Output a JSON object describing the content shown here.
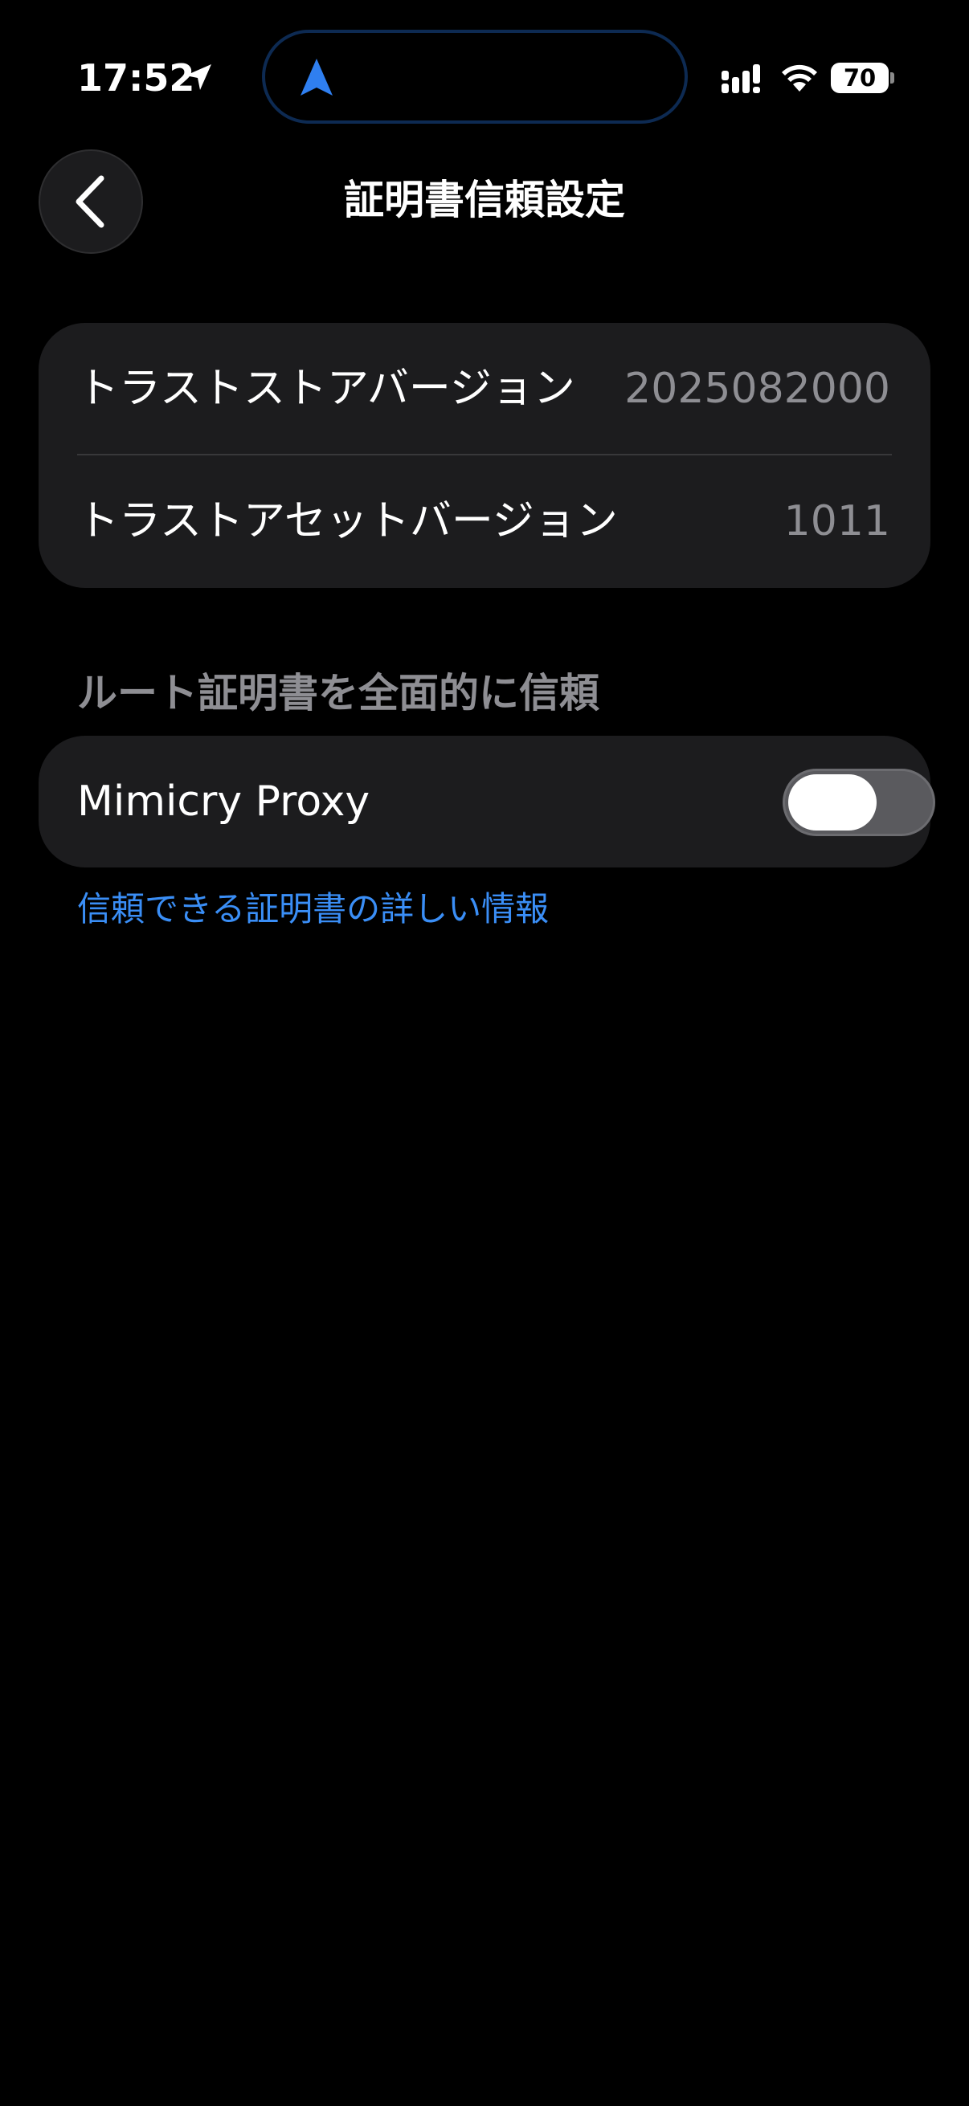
{
  "status_bar": {
    "time": "17:52",
    "battery_level": "70",
    "location_icon": "location-arrow-icon",
    "signal_icon": "cellular-signal-icon",
    "wifi_icon": "wifi-icon",
    "island_icon": "navigation-arrow-icon",
    "island_color": "#2f7ff0"
  },
  "header": {
    "back_icon": "chevron-left-icon",
    "title": "証明書信頼設定"
  },
  "versions": {
    "rows": [
      {
        "label": "トラストストアバージョン",
        "value": "2025082000"
      },
      {
        "label": "トラストアセットバージョン",
        "value": "1011"
      }
    ]
  },
  "trust_section": {
    "header": "ルート証明書を全面的に信頼",
    "items": [
      {
        "label": "Mimicry Proxy",
        "enabled": false
      }
    ]
  },
  "footer": {
    "link_text": "信頼できる証明書の詳しい情報"
  },
  "colors": {
    "background": "#000000",
    "card": "#1c1c1e",
    "secondary_text": "#8e8e93",
    "link": "#3a8ef6",
    "toggle_off": "#5a5a5e"
  }
}
